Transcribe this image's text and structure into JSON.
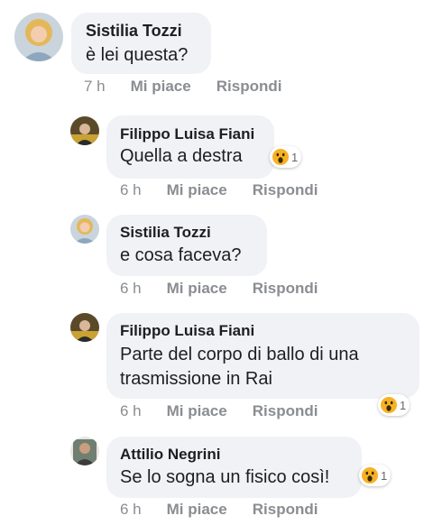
{
  "comments": [
    {
      "author": "Sistilia Tozzi",
      "text": "è lei questa?",
      "time": "7 h",
      "like": "Mi piace",
      "reply": "Rispondi",
      "reaction_count": ""
    },
    {
      "author": "Filippo Luisa Fiani",
      "text": "Quella a destra",
      "time": "6 h",
      "like": "Mi piace",
      "reply": "Rispondi",
      "reaction_count": "1"
    },
    {
      "author": "Sistilia Tozzi",
      "text": "e cosa faceva?",
      "time": "6 h",
      "like": "Mi piace",
      "reply": "Rispondi",
      "reaction_count": ""
    },
    {
      "author": "Filippo Luisa Fiani",
      "text": "Parte del corpo di ballo di una\ntrasmissione in Rai",
      "time": "6 h",
      "like": "Mi piace",
      "reply": "Rispondi",
      "reaction_count": "1"
    },
    {
      "author": "Attilio Negrini",
      "text": "Se lo sogna un fisico così!",
      "time": "6 h",
      "like": "Mi piace",
      "reply": "Rispondi",
      "reaction_count": "1"
    }
  ],
  "reaction_icon": "wow-reaction-icon",
  "colors": {
    "bubble": "#f0f2f5",
    "meta": "#8a8d91",
    "text": "#1c1e21",
    "wow": "#f7b125"
  }
}
